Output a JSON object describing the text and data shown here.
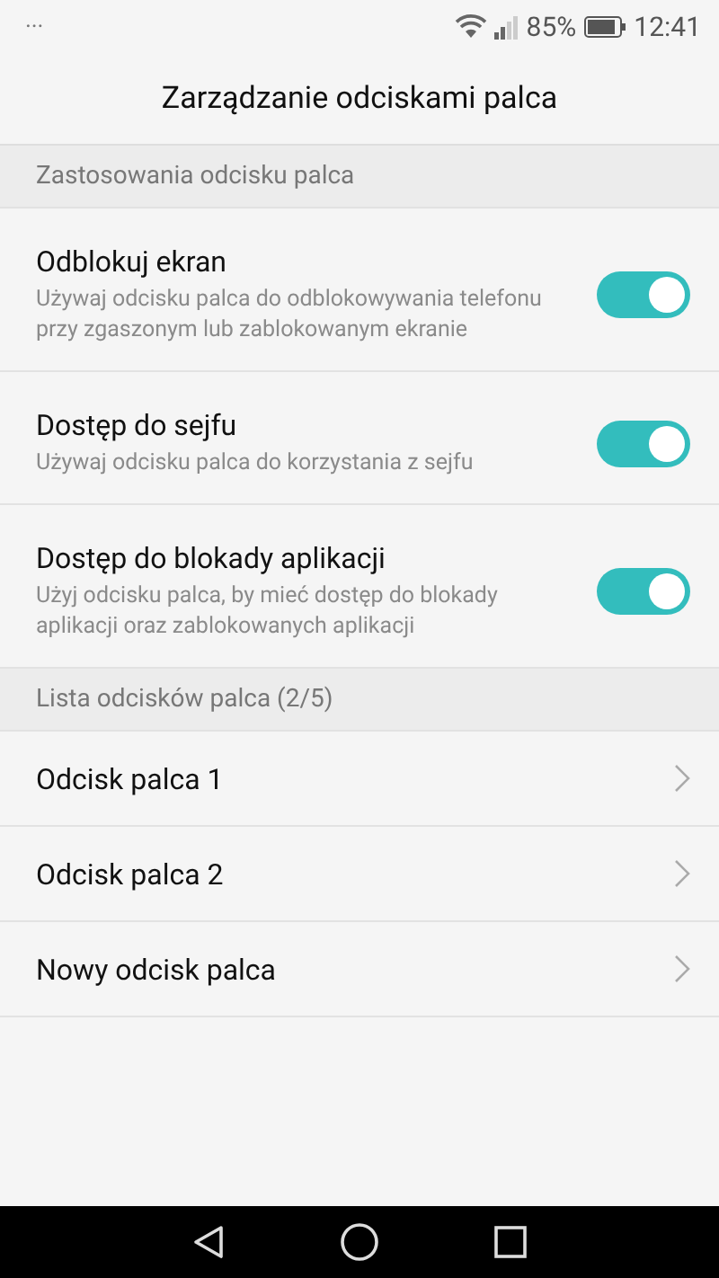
{
  "status_bar": {
    "notifications": "···",
    "battery_percent": "85%",
    "time": "12:41"
  },
  "title": "Zarządzanie odciskami palca",
  "sections": [
    {
      "header": "Zastosowania odcisku palca",
      "kind": "toggles",
      "items": [
        {
          "title": "Odblokuj ekran",
          "description": "Używaj odcisku palca do odblokowywania telefonu przy zgaszonym lub zablokowanym ekranie",
          "on": true
        },
        {
          "title": "Dostęp do sejfu",
          "description": "Używaj odcisku palca do korzystania z sejfu",
          "on": true
        },
        {
          "title": "Dostęp do blokady aplikacji",
          "description": "Użyj odcisku palca, by mieć dostęp do blokady aplikacji oraz zablokowanych aplikacji",
          "on": true
        }
      ]
    },
    {
      "header": "Lista odcisków palca (2/5)",
      "kind": "links",
      "items": [
        {
          "title": "Odcisk palca 1"
        },
        {
          "title": "Odcisk palca 2"
        },
        {
          "title": "Nowy odcisk palca"
        }
      ]
    }
  ]
}
